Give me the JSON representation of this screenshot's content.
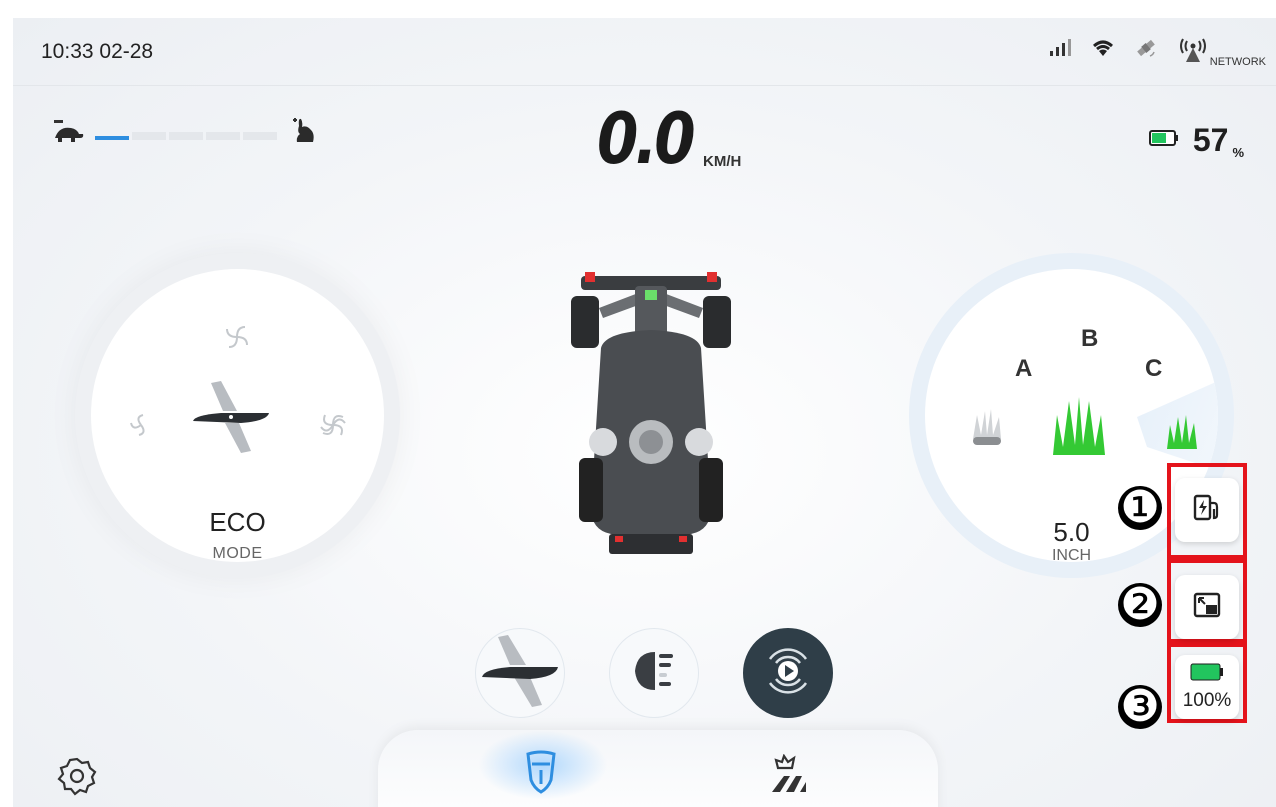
{
  "status_bar": {
    "time": "10:33 02-28",
    "network_label": "NETWORK",
    "icons": [
      "signal-icon",
      "wifi-icon",
      "satellite-icon",
      "network-antenna-icon"
    ]
  },
  "speed": {
    "value": "0.0",
    "unit": "KM/H",
    "slow_icon": "turtle-icon",
    "fast_icon": "rabbit-icon",
    "level_fraction": 0.2
  },
  "battery": {
    "percent": "57",
    "percent_sign": "%",
    "icon": "battery-icon",
    "color": "#22c55e"
  },
  "mode_dial": {
    "mode": "ECO",
    "label": "MODE",
    "icons": [
      "blade-icon",
      "fan-low-icon",
      "fan-mid-icon",
      "fan-high-icon"
    ]
  },
  "height_dial": {
    "value": "5.0",
    "unit": "INCH",
    "presets": [
      "A",
      "B",
      "C"
    ],
    "accent": "#2e8ee0",
    "grass_color": "#34c934"
  },
  "controls": [
    {
      "name": "blade-control-button",
      "icon": "blade-icon"
    },
    {
      "name": "headlight-button",
      "icon": "headlight-icon"
    },
    {
      "name": "autopilot-button",
      "icon": "autopilot-play-icon"
    }
  ],
  "bottom_nav": {
    "items": [
      "drive-shield-icon",
      "field-mowing-icon"
    ],
    "settings_icon": "gear-icon"
  },
  "side_panel": {
    "badges": [
      "❶",
      "❷",
      "❸"
    ],
    "buttons": [
      "charging-station-icon",
      "minimize-window-icon"
    ],
    "battery_text": "100%"
  }
}
